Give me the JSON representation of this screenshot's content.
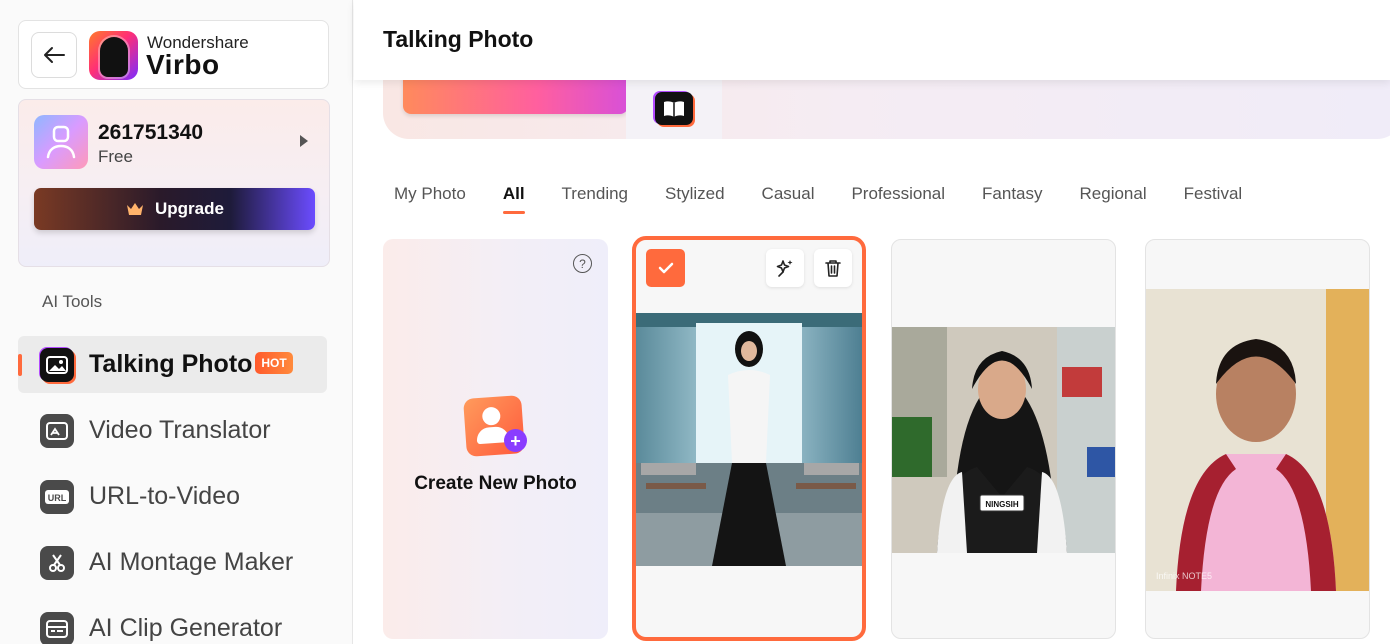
{
  "brand": {
    "top": "Wondershare",
    "main": "Virbo"
  },
  "user": {
    "id": "261751340",
    "plan": "Free",
    "upgrade_label": "Upgrade"
  },
  "sidebar": {
    "section_label": "AI Tools",
    "items": [
      {
        "label": "Talking Photo",
        "badge": "HOT",
        "icon": "talking-photo-icon",
        "active": true
      },
      {
        "label": "Video Translator",
        "icon": "video-translator-icon"
      },
      {
        "label": "URL-to-Video",
        "icon": "url-icon"
      },
      {
        "label": "AI Montage Maker",
        "icon": "montage-icon"
      },
      {
        "label": "AI Clip Generator",
        "icon": "clip-generator-icon"
      }
    ]
  },
  "header": {
    "title": "Talking Photo"
  },
  "tabs": [
    "My Photo",
    "All",
    "Trending",
    "Stylized",
    "Casual",
    "Professional",
    "Fantasy",
    "Regional",
    "Festival"
  ],
  "active_tab": "All",
  "create_card": {
    "label": "Create New Photo"
  },
  "photos": [
    {
      "name": "photo-1",
      "selected": true
    },
    {
      "name": "photo-2",
      "badge_text": "NINGSIH"
    },
    {
      "name": "photo-3",
      "watermark": "Infinix NOTE5"
    }
  ],
  "colors": {
    "accent": "#ff6a3d",
    "hot": "#ff5a2c"
  }
}
